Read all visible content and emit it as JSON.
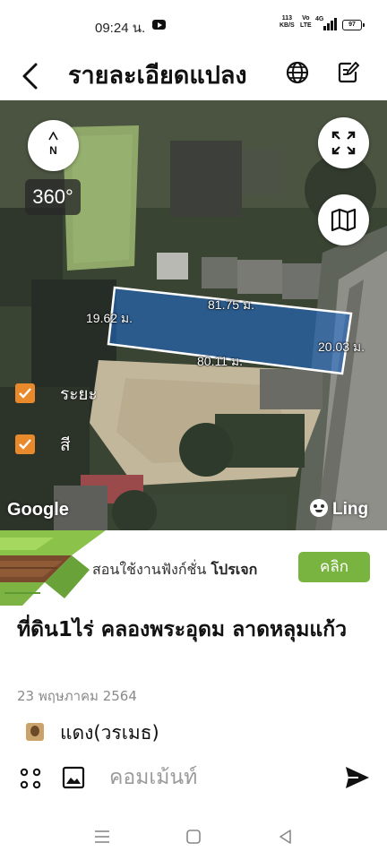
{
  "status_bar": {
    "time": "09:24 น.",
    "net_speed_value": "113",
    "net_speed_unit": "KB/S",
    "volte_top": "Vo",
    "volte_bottom": "LTE",
    "network": "4G",
    "battery": "97",
    "icons": [
      "youtube-icon",
      "signal-icon",
      "battery-icon"
    ]
  },
  "app_bar": {
    "title": "รายละเอียดแปลง",
    "icons": [
      "back-arrow-icon",
      "globe-icon",
      "edit-note-icon"
    ]
  },
  "map": {
    "compass_label": "N",
    "view_360_label": "360°",
    "plot_color": "#1f6fd6",
    "dimensions": {
      "left": "19.62 ม.",
      "top": "81.75 ม.",
      "bottom": "80.11 ม.",
      "right": "20.03 ม."
    },
    "layers": [
      {
        "label": "ระยะ",
        "checked": true
      },
      {
        "label": "สี",
        "checked": true
      }
    ],
    "attribution_google": "Google",
    "attribution_ling": "Ling",
    "icons": [
      "compass-icon",
      "fullscreen-icon",
      "map-type-icon",
      "checkbox-icon",
      "ling-icon"
    ]
  },
  "banner": {
    "text_prefix": "สอนใช้งานฟังก์ชั่น ",
    "text_bold": "โปรเจก",
    "button_label": "คลิก",
    "accent_color": "#79b441"
  },
  "post": {
    "title": "ที่ดิน1ไร่ คลองพระอุดม ลาดหลุมแก้ว",
    "date": "23 พฤษภาคม 2564",
    "author": "แดง(วรเมธ)"
  },
  "comment_bar": {
    "placeholder": "คอมเม้นท์",
    "icons": [
      "apps-grid-icon",
      "image-icon",
      "send-icon"
    ]
  },
  "nav_bar": {
    "icons": [
      "menu-icon",
      "home-square-icon",
      "back-triangle-icon"
    ]
  }
}
